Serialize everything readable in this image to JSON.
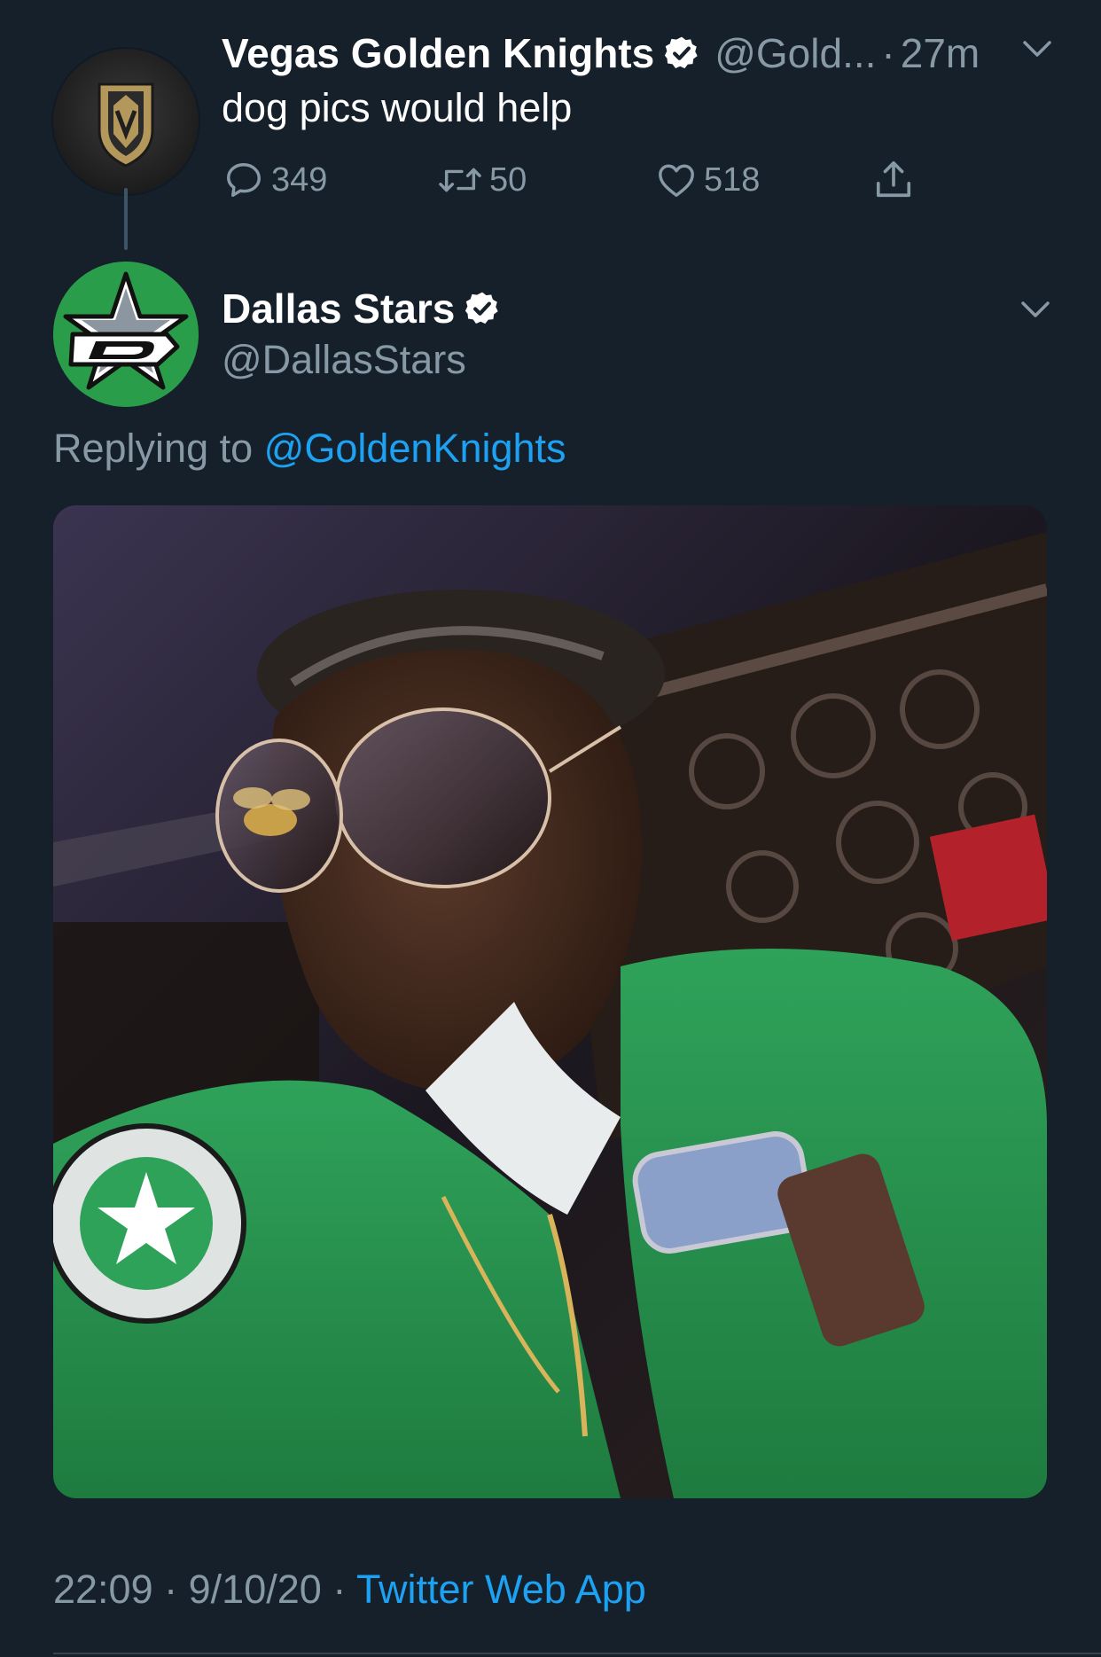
{
  "parent_tweet": {
    "display_name": "Vegas Golden Knights",
    "handle": "@Gold...",
    "separator": "·",
    "time": "27m",
    "text": "dog pics would help",
    "reply_count": "349",
    "retweet_count": "50",
    "like_count": "518"
  },
  "main_tweet": {
    "display_name": "Dallas Stars",
    "handle": "@DallasStars",
    "replying_label": "Replying to",
    "replying_to": "@GoldenKnights",
    "time": "22:09",
    "date": "9/10/20",
    "source": "Twitter Web App",
    "separator": "·"
  },
  "colors": {
    "background": "#15202b",
    "accent": "#1da1f2",
    "muted": "#8899a6",
    "dallas_green": "#2a9d4a",
    "vegas_gold": "#b4975a"
  },
  "icons": [
    "verified-badge-icon",
    "chevron-down-icon",
    "reply-icon",
    "retweet-icon",
    "like-icon",
    "share-icon"
  ]
}
